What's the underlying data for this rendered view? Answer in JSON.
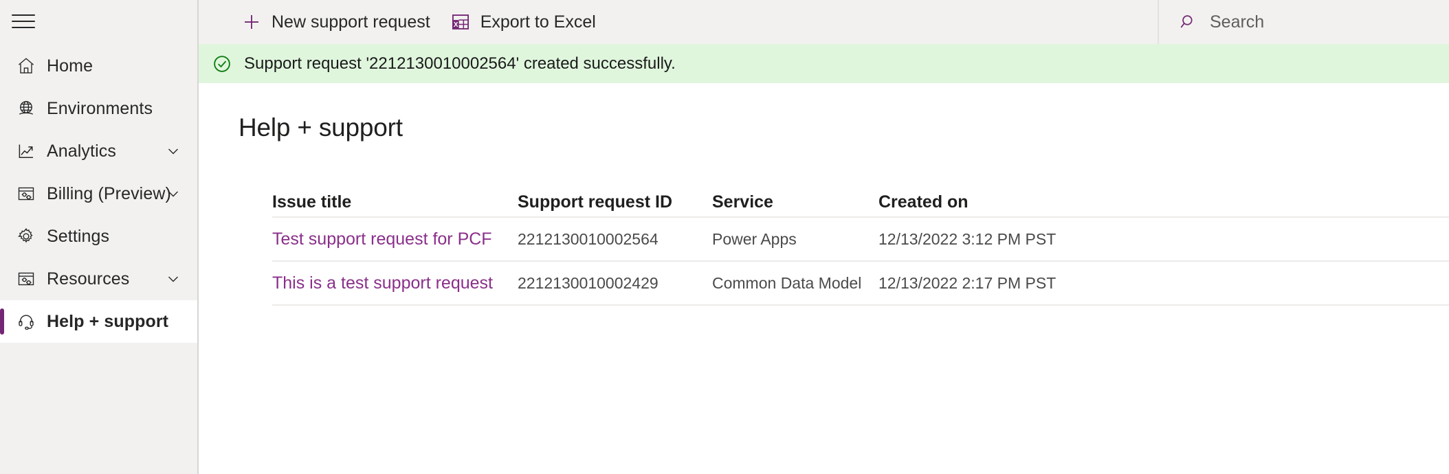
{
  "sidebar": {
    "menu_icon": "hamburger-icon",
    "items": [
      {
        "label": "Home",
        "icon": "home-icon",
        "chevron": false,
        "selected": false
      },
      {
        "label": "Environments",
        "icon": "globe-icon",
        "chevron": false,
        "selected": false
      },
      {
        "label": "Analytics",
        "icon": "chart-line-icon",
        "chevron": true,
        "selected": false
      },
      {
        "label": "Billing (Preview)",
        "icon": "billing-icon",
        "chevron": true,
        "selected": false
      },
      {
        "label": "Settings",
        "icon": "gear-icon",
        "chevron": false,
        "selected": false
      },
      {
        "label": "Resources",
        "icon": "resources-icon",
        "chevron": true,
        "selected": false
      },
      {
        "label": "Help + support",
        "icon": "headset-icon",
        "chevron": false,
        "selected": true
      }
    ]
  },
  "toolbar": {
    "new_request_label": "New support request",
    "new_request_icon": "plus-icon",
    "export_excel_label": "Export to Excel",
    "export_excel_icon": "excel-icon",
    "search_placeholder": "Search",
    "search_value": "",
    "search_icon": "search-icon"
  },
  "notification": {
    "icon": "check-circle-icon",
    "message": "Support request '2212130010002564' created successfully.",
    "background": "#dff6dd",
    "icon_color": "#107c10"
  },
  "main": {
    "page_title": "Help + support",
    "table": {
      "columns": [
        "Issue title",
        "Support request ID",
        "Service",
        "Created on"
      ],
      "rows": [
        {
          "issue_title": "Test support request for PCF",
          "support_request_id": "2212130010002564",
          "service": "Power Apps",
          "created_on": "12/13/2022 3:12 PM PST"
        },
        {
          "issue_title": "This is a test support request",
          "support_request_id": "2212130010002429",
          "service": "Common Data Model",
          "created_on": "12/13/2022 2:17 PM PST"
        }
      ]
    }
  },
  "colors": {
    "accent": "#742774",
    "link": "#8a2f8a",
    "sidebar_bg": "#f2f1f0",
    "success_bg": "#dff6dd"
  }
}
